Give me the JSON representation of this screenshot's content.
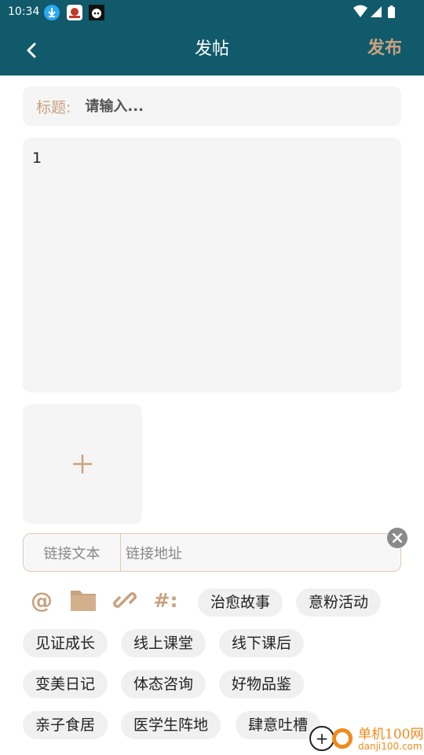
{
  "status_bar": {
    "time": "10:34",
    "icons": [
      "download-icon",
      "app-icon",
      "cat-app-icon",
      "wifi-icon",
      "signal-icon",
      "battery-icon"
    ]
  },
  "header": {
    "title": "发帖",
    "publish_label": "发布",
    "bg_color": "#115a6b",
    "accent_color": "#c9a27f"
  },
  "form": {
    "title_label": "标题:",
    "title_placeholder": "请输入...",
    "content_value": "1",
    "link_text_placeholder": "链接文本",
    "link_url_placeholder": "链接地址"
  },
  "tools": {
    "at_symbol": "@",
    "topic_symbol": "#:"
  },
  "tags": [
    "治愈故事",
    "意粉活动",
    "见证成长",
    "线上课堂",
    "线下课后",
    "变美日记",
    "体态咨询",
    "好物品鉴",
    "亲子食居",
    "医学生阵地",
    "肆意吐槽"
  ],
  "watermark": {
    "title": "单机100网",
    "url": "danji100.com"
  }
}
